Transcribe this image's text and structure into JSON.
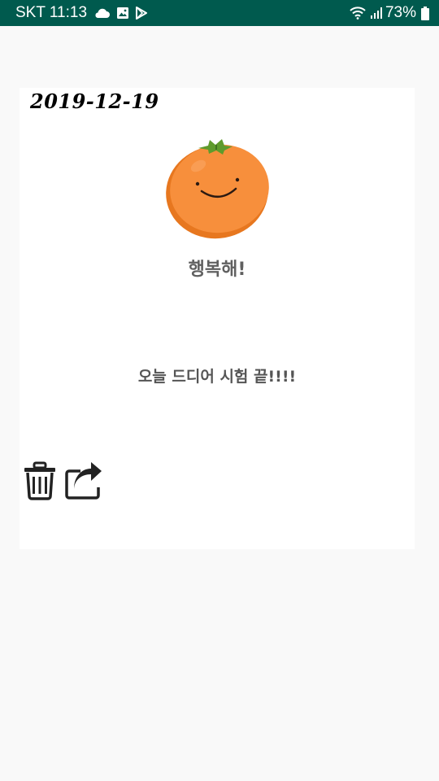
{
  "status_bar": {
    "carrier_time": "SKT 11:13",
    "battery_percent": "73%",
    "icons": [
      "cloud-icon",
      "image-icon",
      "play-store-icon",
      "wifi-icon",
      "signal-icon",
      "battery-icon"
    ]
  },
  "entry": {
    "date": "2019-12-19",
    "mood_image": "smiling-persimmon",
    "mood_label": "행복해!",
    "content": "오늘 드디어 시험 끝!!!!"
  },
  "actions": {
    "delete_icon": "trash-icon",
    "share_icon": "share-icon"
  },
  "colors": {
    "status_bar": "#005a4e",
    "background": "#f9f9f9",
    "card": "#ffffff",
    "persimmon": "#f58a34",
    "text_gray": "#606060"
  }
}
